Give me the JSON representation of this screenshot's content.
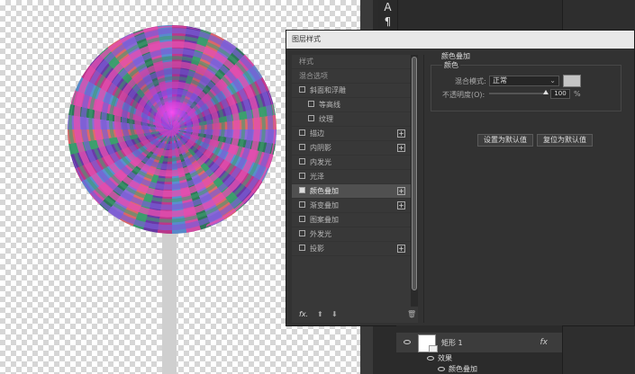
{
  "canvas": {
    "candy_colors": [
      "#c0398d",
      "#6a3aa8",
      "#3aa06d",
      "#e06a6a",
      "#8b6bd8",
      "#2d7c5a",
      "#d84fa8",
      "#5a8fd0"
    ],
    "stick_color": "#cfcfcf"
  },
  "tools": {
    "text_tool": "A",
    "para_tool": "¶"
  },
  "dialog": {
    "title": "图层样式",
    "styles": [
      {
        "label": "样式",
        "head": true
      },
      {
        "label": "混合选项",
        "head": true
      },
      {
        "label": "斜面和浮雕",
        "checked": false
      },
      {
        "label": "等高线",
        "checked": false,
        "indent": true
      },
      {
        "label": "纹理",
        "checked": false,
        "indent": true
      },
      {
        "label": "描边",
        "checked": false,
        "plus": true
      },
      {
        "label": "内阴影",
        "checked": false,
        "plus": true
      },
      {
        "label": "内发光",
        "checked": false
      },
      {
        "label": "光泽",
        "checked": false
      },
      {
        "label": "颜色叠加",
        "checked": true,
        "plus": true,
        "selected": true
      },
      {
        "label": "渐变叠加",
        "checked": false,
        "plus": true
      },
      {
        "label": "图案叠加",
        "checked": false
      },
      {
        "label": "外发光",
        "checked": false
      },
      {
        "label": "投影",
        "checked": false,
        "plus": true
      }
    ],
    "footer": {
      "fx": "fx.",
      "up": "⬆",
      "down": "⬇",
      "trash": "🗑"
    },
    "props": {
      "section_title": "颜色叠加",
      "group_title": "颜色",
      "blend_mode_label": "混合模式:",
      "blend_mode_value": "正常",
      "overlay_color": "#c4c4c4",
      "opacity_label": "不透明度(O):",
      "opacity_value": "100",
      "opacity_unit": "%",
      "btn_set_default": "设置为默认值",
      "btn_reset_default": "复位为默认值"
    }
  },
  "layers": {
    "layer_name": "矩形 1",
    "fx": "fx",
    "effects_label": "效果",
    "effect_item": "颜色叠加"
  }
}
